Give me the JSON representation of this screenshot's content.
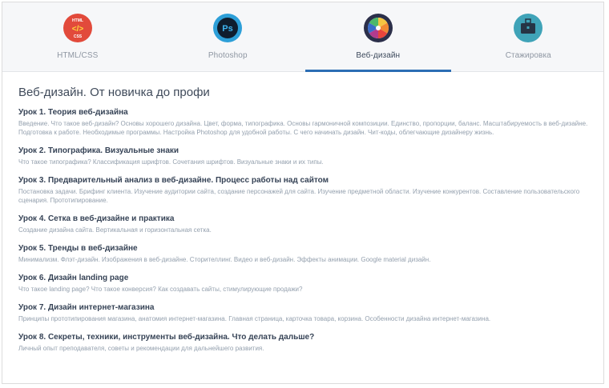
{
  "tabs": [
    {
      "label": "HTML/CSS",
      "icon": "html-css-icon",
      "icon_text_top": "HTML",
      "icon_text_mid": "</>",
      "icon_text_bot": "CSS",
      "active": false
    },
    {
      "label": "Photoshop",
      "icon": "photoshop-icon",
      "icon_text": "Ps",
      "active": false
    },
    {
      "label": "Веб-дизайн",
      "icon": "color-wheel-icon",
      "active": true
    },
    {
      "label": "Стажировка",
      "icon": "briefcase-icon",
      "active": false
    }
  ],
  "course": {
    "title": "Веб-дизайн. От новичка до профи",
    "lessons": [
      {
        "title": "Урок 1. Теория веб-дизайна",
        "description": "Введение. Что такое веб-дизайн? Основы хорошего дизайна. Цвет, форма, типографика. Основы гармоничной композиции. Единство, пропорции, баланс. Масштабируемость в веб-дизайне. Подготовка к работе. Необходимые программы. Настройка Photoshop для удобной работы. С чего начинать дизайн. Чит-коды, облегчающие дизайнеру жизнь."
      },
      {
        "title": "Урок 2. Типографика. Визуальные знаки",
        "description": "Что такое типографика? Классификация шрифтов. Сочетания шрифтов. Визуальные знаки и их типы."
      },
      {
        "title": "Урок 3. Предварительный анализ в веб-дизайне. Процесс работы над сайтом",
        "description": "Постановка задачи. Брифинг клиента. Изучение аудитории сайта, создание персонажей для сайта. Изучение предметной области. Изучение конкурентов. Составление пользовательского сценария. Прототипирование."
      },
      {
        "title": "Урок 4. Сетка в веб-дизайне и практика",
        "description": "Создание дизайна сайта. Вертикальная и горизонтальная сетка."
      },
      {
        "title": "Урок 5. Тренды в веб-дизайне",
        "description": "Минимализм. Флэт-дизайн. Изображения в веб-дизайне. Сторителлинг. Видео и веб-дизайн. Эффекты анимации. Google material дизайн."
      },
      {
        "title": "Урок 6. Дизайн landing page",
        "description": "Что такое landing page? Что такое конверсия? Как создавать сайты, стимулирующие продажи?"
      },
      {
        "title": "Урок 7. Дизайн интернет-магазина",
        "description": "Принципы прототипирования магазина, анатомия интернет-магазина. Главная страница, карточка товара, корзина. Особенности дизайна интернет-магазина."
      },
      {
        "title": "Урок 8. Секреты, техники, инструменты веб-дизайна. Что делать дальше?",
        "description": "Личный опыт преподавателя, советы и рекомендации для дальнейшего развития."
      }
    ]
  }
}
